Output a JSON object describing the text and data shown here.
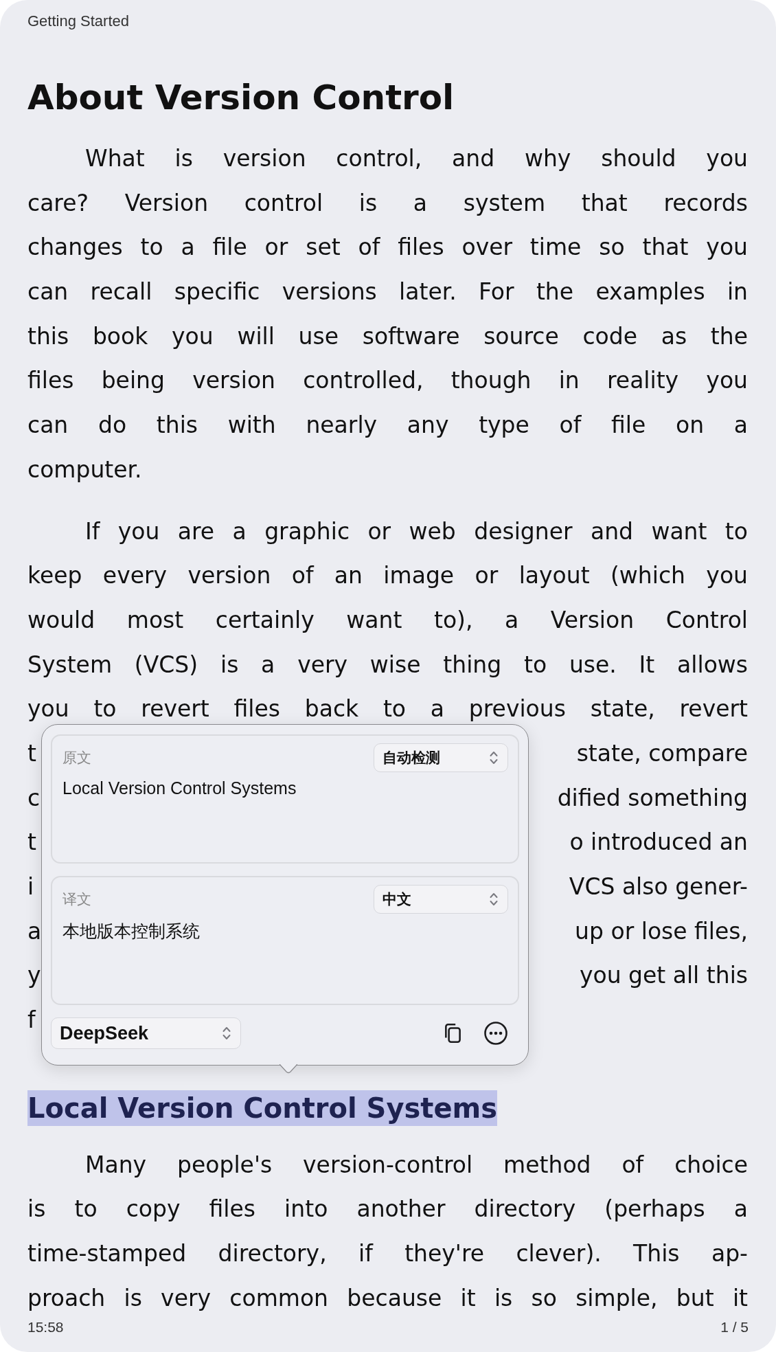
{
  "header": {
    "title": "Getting Started"
  },
  "blocks": [
    {
      "kind": "title",
      "text": "About Version Control"
    },
    {
      "kind": "paragraph",
      "complete": true,
      "lines": [
        {
          "text": "What is version control, and why should you"
        },
        {
          "text": "care? Version control is a system that records"
        },
        {
          "text": "changes to a file or set of files over time so that you"
        },
        {
          "text": "can recall specific versions later. For the examples in"
        },
        {
          "text": "this book you will use software source code as the"
        },
        {
          "text": "files being version controlled, though in reality you"
        },
        {
          "text": "can do this with nearly any type of file on a"
        },
        {
          "text": "computer."
        }
      ]
    },
    {
      "kind": "paragraph",
      "complete": true,
      "lines": [
        {
          "text": "If you are a graphic or web designer and want to"
        },
        {
          "text": "keep every version of an image or layout (which you"
        },
        {
          "text": "would most certainly want to), a Version Control"
        },
        {
          "text": "System (VCS) is a very wise thing to use. It allows"
        },
        {
          "text": "you to revert files back to a previous state, revert"
        },
        {
          "left": "t",
          "right": "state, compare"
        },
        {
          "left": "c",
          "right": "dified something"
        },
        {
          "left": "t",
          "right": "o introduced an"
        },
        {
          "left": "i",
          "right": "VCS also gener-"
        },
        {
          "left": "a",
          "right": "up or lose files,"
        },
        {
          "left": "y",
          "right": "you get all this"
        },
        {
          "left": "f"
        }
      ]
    },
    {
      "kind": "heading",
      "text": "Local Version Control Systems",
      "selected": true
    },
    {
      "kind": "paragraph",
      "complete": false,
      "lines": [
        {
          "text": "Many people's version-control method of choice"
        },
        {
          "text": "is to copy files into another directory (perhaps a"
        },
        {
          "text": "time-stamped directory, if they're clever). This ap-"
        },
        {
          "text": "proach is very common because it is so simple, but it"
        }
      ]
    }
  ],
  "popover": {
    "source": {
      "label": "原文",
      "language": "自动检测",
      "text": "Local Version Control Systems"
    },
    "target": {
      "label": "译文",
      "language": "中文",
      "text": "本地版本控制系统"
    },
    "engine": "DeepSeek"
  },
  "footer": {
    "time": "15:58",
    "page": "1 / 5"
  }
}
